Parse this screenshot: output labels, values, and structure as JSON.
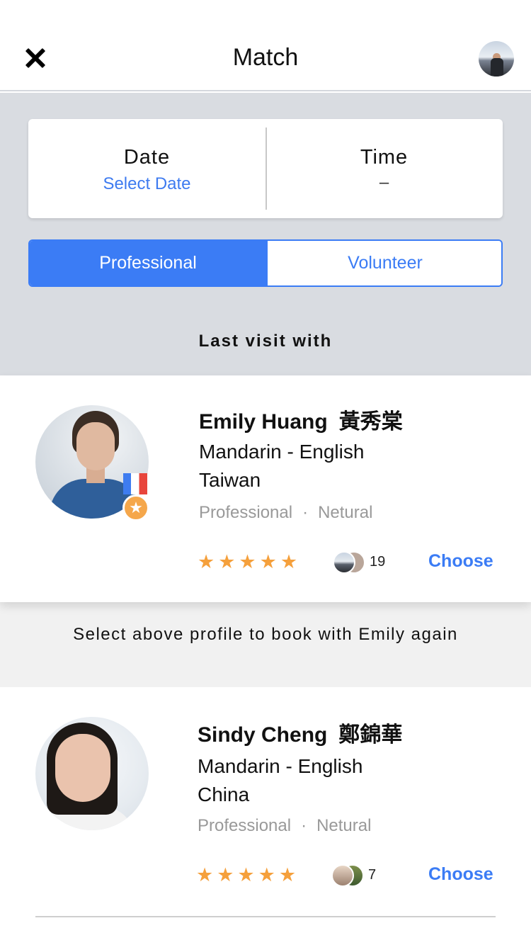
{
  "header": {
    "title": "Match"
  },
  "datetime": {
    "date_label": "Date",
    "date_value": "Select Date",
    "time_label": "Time",
    "time_value": "–"
  },
  "segment": {
    "options": [
      "Professional",
      "Volunteer"
    ],
    "selected": "Professional"
  },
  "section_label": "Last visit with",
  "profiles": [
    {
      "name": "Emily Huang",
      "name_cn": "黃秀棠",
      "languages": "Mandarin - English",
      "region": "Taiwan",
      "type": "Professional",
      "dot": "·",
      "accent": "Netural",
      "rating": 5,
      "stars": "★★★★★",
      "count": "19",
      "action": "Choose",
      "badge": "medal"
    },
    {
      "name": "Sindy Cheng",
      "name_cn": "鄭錦華",
      "languages": "Mandarin - English",
      "region": "China",
      "type": "Professional",
      "dot": "·",
      "accent": "Netural",
      "rating": 5,
      "stars": "★★★★★",
      "count": "7",
      "action": "Choose"
    }
  ],
  "hint": "Select above profile to book with Emily again",
  "icons": {
    "close": "close-icon",
    "user": "user-avatar",
    "star": "star-icon",
    "medal": "medal-icon"
  },
  "colors": {
    "accent": "#3b7cf5",
    "star": "#f5a03c",
    "muted": "#999999",
    "gray_bg": "#d9dce1"
  }
}
